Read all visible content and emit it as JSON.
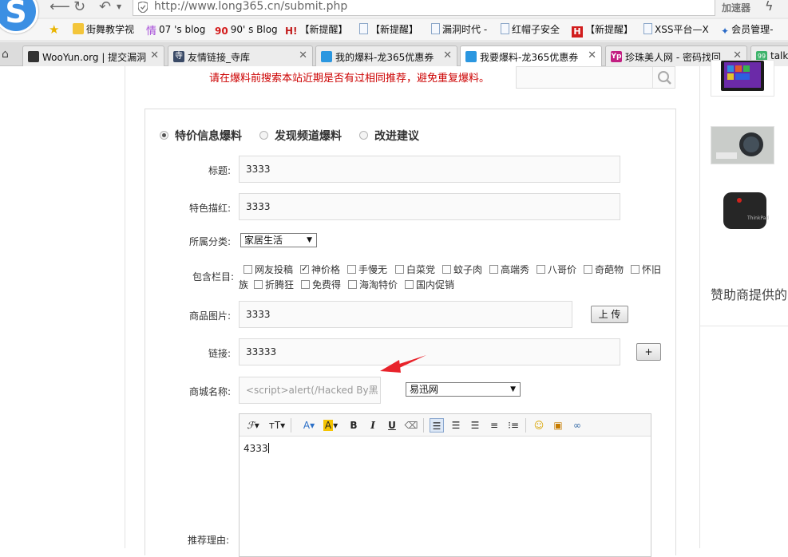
{
  "browser": {
    "url": "http://www.long365.cn/submit.php",
    "accelerator_label": "加速器",
    "bookmarks": [
      {
        "label": "街舞教学视",
        "icon": "folder-star-icon"
      },
      {
        "label": "07 's blog",
        "icon": "blog-icon"
      },
      {
        "label": "90' s Blog",
        "icon": "ninety-logo-icon"
      },
      {
        "label": "【新提醒】",
        "icon": "hackbbs-icon"
      },
      {
        "label": "【新提醒】",
        "icon": "page-icon"
      },
      {
        "label": "漏洞时代 -",
        "icon": "page-icon"
      },
      {
        "label": "红帽子安全",
        "icon": "page-icon"
      },
      {
        "label": "【新提醒】",
        "icon": "h-logo-icon"
      },
      {
        "label": "XSS平台—X",
        "icon": "page-icon"
      },
      {
        "label": "会员管理-",
        "icon": "sparkle-icon"
      }
    ],
    "tabs": [
      {
        "label": "WooYun.org | 提交漏洞",
        "icon": "wooyun-icon",
        "active": false
      },
      {
        "label": "友情链接_寺库",
        "icon": "siku-icon",
        "active": false
      },
      {
        "label": "我的爆料-龙365优惠券",
        "icon": "long365-icon",
        "active": false
      },
      {
        "label": "我要爆料-龙365优惠券",
        "icon": "long365-icon",
        "active": true
      },
      {
        "label": "珍珠美人网 - 密码找回",
        "icon": "yp-icon",
        "active": false
      },
      {
        "label": "talk",
        "icon": "talk-icon",
        "active": false
      }
    ]
  },
  "page": {
    "notice": "请在爆料前搜索本站近期是否有过相同推荐，避免重复爆料。",
    "search_placeholder": "",
    "sponsor_heading": "赞助商提供的"
  },
  "form": {
    "types": [
      {
        "label": "特价信息爆料",
        "selected": true
      },
      {
        "label": "发现频道爆料",
        "selected": false
      },
      {
        "label": "改进建议",
        "selected": false
      }
    ],
    "title_label": "标题:",
    "title_value": "3333",
    "highlight_label": "特色描红:",
    "highlight_value": "3333",
    "category_label": "所属分类:",
    "category_value": "家居生活",
    "columns_label": "包含栏目:",
    "columns": [
      {
        "label": "网友投稿",
        "checked": false
      },
      {
        "label": "神价格",
        "checked": true
      },
      {
        "label": "手慢无",
        "checked": false
      },
      {
        "label": "白菜党",
        "checked": false
      },
      {
        "label": "蚊子肉",
        "checked": false
      },
      {
        "label": "高端秀",
        "checked": false
      },
      {
        "label": "八哥价",
        "checked": false
      },
      {
        "label": "奇葩物",
        "checked": false
      },
      {
        "label": "怀旧",
        "checked": false
      },
      {
        "label": "族",
        "checked": false
      },
      {
        "label": "折腾狂",
        "checked": false
      },
      {
        "label": "免费得",
        "checked": false
      },
      {
        "label": "海淘特价",
        "checked": false
      },
      {
        "label": "国内促销",
        "checked": false
      }
    ],
    "image_label": "商品图片:",
    "image_value": "3333",
    "upload_button": "上 传",
    "link_label": "链接:",
    "link_value": "33333",
    "add_button": "+",
    "mall_label": "商城名称:",
    "mall_value": "<script>alert(/Hacked By黑",
    "mall_select": "易迅网",
    "reason_label": "推荐理由:",
    "editor_content": "4333"
  },
  "colors": {
    "notice": "#cc0000",
    "annotation_arrow": "#e8232b"
  }
}
